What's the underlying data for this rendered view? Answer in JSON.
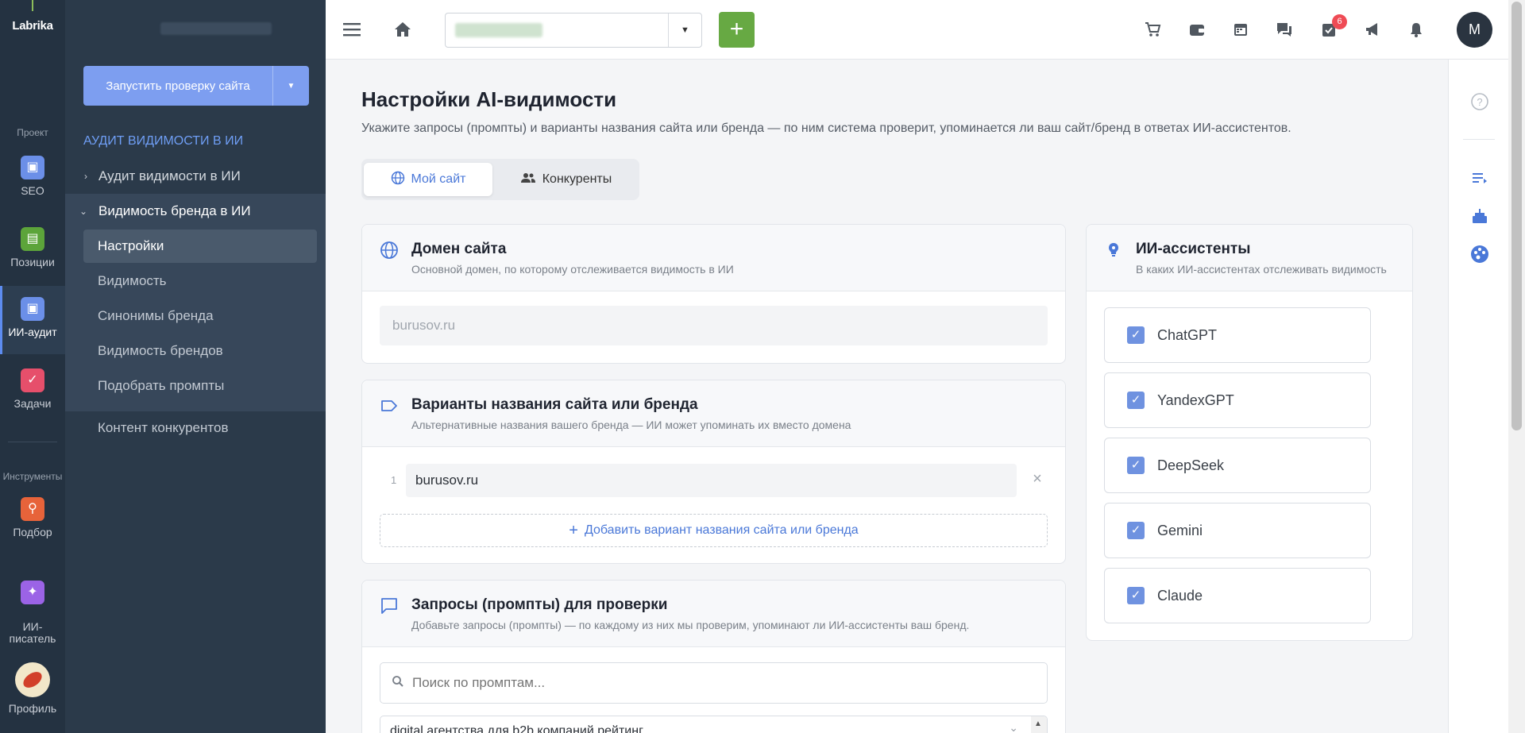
{
  "app": {
    "logo": "Labrika"
  },
  "rail": {
    "section_project": "Проект",
    "section_tools": "Инструменты",
    "items": [
      {
        "label": "SEO",
        "icon": "clipboard-icon",
        "color": "#6b8fe8"
      },
      {
        "label": "Позиции",
        "icon": "chart-icon",
        "color": "#5ca43a"
      },
      {
        "label": "ИИ-аудит",
        "icon": "clipboard-check-icon",
        "color": "#6b8fe8"
      },
      {
        "label": "Задачи",
        "icon": "check-icon",
        "color": "#e64f6b"
      },
      {
        "label": "Подбор",
        "icon": "magnifier-icon",
        "color": "#e7633a"
      },
      {
        "label": "ИИ-\nписатель",
        "icon": "magic-wand-icon",
        "color": "#9b63e6"
      },
      {
        "label": "Профиль",
        "icon": "profile-logo-icon",
        "color": "#f2e7c9"
      }
    ]
  },
  "sidebar": {
    "run_button": "Запустить проверку сайта",
    "section_title": "АУДИТ ВИДИМОСТИ В ИИ",
    "nav": [
      {
        "label": "Аудит видимости в ИИ"
      },
      {
        "label": "Видимость бренда в ИИ"
      }
    ],
    "sub": [
      {
        "label": "Настройки"
      },
      {
        "label": "Видимость"
      },
      {
        "label": "Синонимы бренда"
      },
      {
        "label": "Видимость брендов"
      },
      {
        "label": "Подобрать промпты"
      }
    ],
    "extra": "Контент конкурентов"
  },
  "header": {
    "notification_count": "6",
    "avatar_letter": "M"
  },
  "page": {
    "title": "Настройки AI-видимости",
    "description": "Укажите запросы (промпты) и варианты названия сайта или бренда — по ним система проверит, упоминается ли ваш сайт/бренд в ответах ИИ-ассистентов.",
    "tabs": [
      "Мой сайт",
      "Конкуренты"
    ]
  },
  "domain_card": {
    "title": "Домен сайта",
    "subtitle": "Основной домен, по которому отслеживается видимость в ИИ",
    "value": "burusov.ru"
  },
  "variants_card": {
    "title": "Варианты названия сайта или бренда",
    "subtitle": "Альтернативные названия вашего бренда — ИИ может упоминать их вместо домена",
    "rows": [
      {
        "num": "1",
        "value": "burusov.ru"
      }
    ],
    "add_label": "Добавить вариант названия сайта или бренда"
  },
  "prompts_card": {
    "title": "Запросы (промпты) для проверки",
    "subtitle": "Добавьте запросы (промпты) — по каждому из них мы проверим, упоминают ли ИИ-ассистенты ваш бренд.",
    "search_placeholder": "Поиск по промптам...",
    "first_prompt": "digital агентства для b2b компаний рейтинг"
  },
  "assistants_card": {
    "title": "ИИ-ассистенты",
    "subtitle": "В каких ИИ-ассистентах отслеживать видимость",
    "items": [
      "ChatGPT",
      "YandexGPT",
      "DeepSeek",
      "Gemini",
      "Claude"
    ]
  },
  "colors": {
    "accent": "#4a78d8",
    "green": "#67a943",
    "sidebar": "#2b3a4a",
    "rail": "#243241"
  }
}
